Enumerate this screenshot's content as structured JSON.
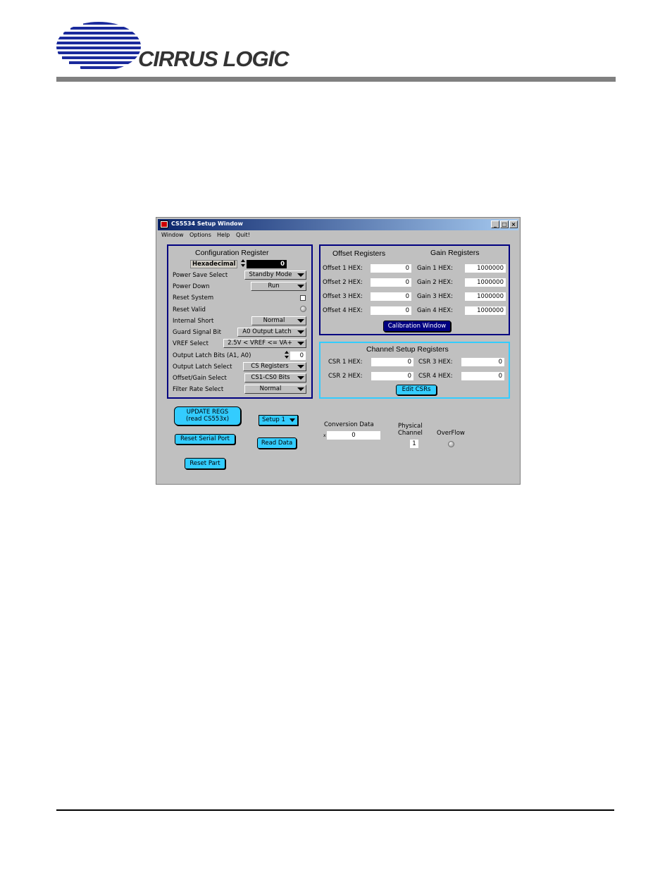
{
  "header": {
    "logo_text": "CIRRUS LOGIC",
    "logo_reg": "®"
  },
  "window": {
    "title": "CS5534 Setup Window",
    "controls": {
      "minimize": "_",
      "maximize": "□",
      "close": "×"
    },
    "menu": [
      "Window",
      "Options",
      "Help",
      "Quit!"
    ]
  },
  "config": {
    "title": "Configuration Register",
    "hex_label": "Hexadecimal",
    "hex_value": "0",
    "rows": [
      {
        "label": "Power Save Select",
        "value": "Standby Mode"
      },
      {
        "label": "Power Down",
        "value": "Run"
      },
      {
        "label": "Reset System"
      },
      {
        "label": "Reset Valid"
      },
      {
        "label": "Internal Short",
        "value": "Normal"
      },
      {
        "label": "Guard Signal Bit",
        "value": "A0 Output Latch"
      },
      {
        "label": "VREF Select",
        "value": "2.5V < VREF <= VA+"
      },
      {
        "label": "Output Latch Bits (A1, A0)",
        "value": "0"
      },
      {
        "label": "Output Latch Select",
        "value": "CS Registers"
      },
      {
        "label": "Offset/Gain Select",
        "value": "CS1-CS0 Bits"
      },
      {
        "label": "Filter Rate Select",
        "value": "Normal"
      }
    ]
  },
  "offset_gain": {
    "offset_title": "Offset Registers",
    "gain_title": "Gain Registers",
    "offsets": [
      {
        "label": "Offset 1 HEX:",
        "value": "0"
      },
      {
        "label": "Offset 2 HEX:",
        "value": "0"
      },
      {
        "label": "Offset 3 HEX:",
        "value": "0"
      },
      {
        "label": "Offset 4 HEX:",
        "value": "0"
      }
    ],
    "gains": [
      {
        "label": "Gain 1 HEX:",
        "value": "1000000"
      },
      {
        "label": "Gain 2 HEX:",
        "value": "1000000"
      },
      {
        "label": "Gain 3 HEX:",
        "value": "1000000"
      },
      {
        "label": "Gain 4 HEX:",
        "value": "1000000"
      }
    ],
    "calibration_button": "Calibration Window"
  },
  "csr": {
    "title": "Channel Setup Registers",
    "fields": [
      {
        "label": "CSR 1 HEX:",
        "value": "0"
      },
      {
        "label": "CSR 3 HEX:",
        "value": "0"
      },
      {
        "label": "CSR 2 HEX:",
        "value": "0"
      },
      {
        "label": "CSR 4 HEX:",
        "value": "0"
      }
    ],
    "edit_button": "Edit CSRs"
  },
  "actions": {
    "update_line1": "UPDATE REGS",
    "update_line2": "(read CS553x)",
    "setup_value": "Setup 1",
    "reset_serial": "Reset Serial Port",
    "read_data": "Read Data",
    "reset_part": "Reset Part"
  },
  "conversion": {
    "label": "Conversion Data",
    "prefix": "x",
    "value": "0",
    "physical_label_1": "Physical",
    "physical_label_2": "Channel",
    "physical_value": "1",
    "overflow_label": "OverFlow"
  },
  "colors": {
    "panel_border": "#000080",
    "csr_border": "#33ccff",
    "button_fill": "#33ccff",
    "calibration_fill": "#000080",
    "logo_blue": "#1a2a9c",
    "header_bar": "#808080"
  }
}
